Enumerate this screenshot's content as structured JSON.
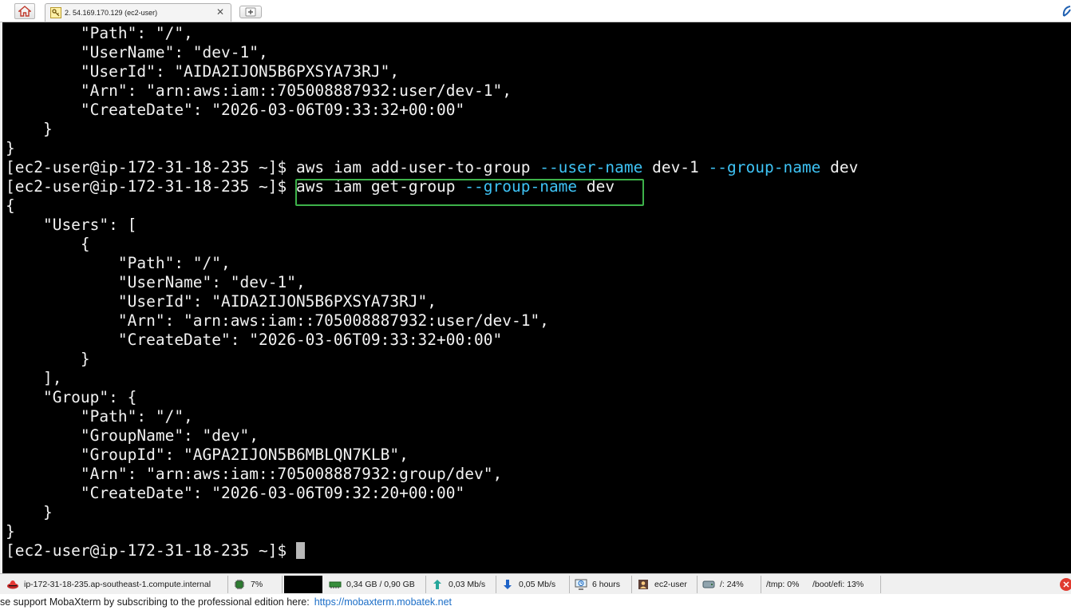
{
  "tab": {
    "title": "2. 54.169.170.129 (ec2-user)",
    "close_glyph": "✕"
  },
  "terminal": {
    "prompt": "[ec2-user@ip-172-31-18-235 ~]$ ",
    "highlight_color": "#3db24a",
    "option_color": "#3ec3f5",
    "lines": [
      "        \"Path\": \"/\",",
      "        \"UserName\": \"dev-1\",",
      "        \"UserId\": \"AIDA2IJON5B6PXSYA73RJ\",",
      "        \"Arn\": \"arn:aws:iam::705008887932:user/dev-1\",",
      "        \"CreateDate\": \"2026-03-06T09:33:32+00:00\"",
      "    }",
      "}",
      "__CMD1__",
      "__CMD2__",
      "{",
      "    \"Users\": [",
      "        {",
      "            \"Path\": \"/\",",
      "            \"UserName\": \"dev-1\",",
      "            \"UserId\": \"AIDA2IJON5B6PXSYA73RJ\",",
      "            \"Arn\": \"arn:aws:iam::705008887932:user/dev-1\",",
      "            \"CreateDate\": \"2026-03-06T09:33:32+00:00\"",
      "        }",
      "    ],",
      "    \"Group\": {",
      "        \"Path\": \"/\",",
      "        \"GroupName\": \"dev\",",
      "        \"GroupId\": \"AGPA2IJON5B6MBLQN7KLB\",",
      "        \"Arn\": \"arn:aws:iam::705008887932:group/dev\",",
      "        \"CreateDate\": \"2026-03-06T09:32:20+00:00\"",
      "    }",
      "}"
    ],
    "cmd1": {
      "base": "aws iam add-user-to-group ",
      "opt1": "--user-name",
      "val1": " dev-1 ",
      "opt2": "--group-name",
      "val2": " dev"
    },
    "cmd2": {
      "base": "aws iam get-group ",
      "opt1": "--group-name",
      "val1": " dev"
    }
  },
  "statusbar": {
    "host": "ip-172-31-18-235.ap-southeast-1.compute.internal",
    "cpu": "7%",
    "memory": "0,34 GB / 0,90 GB",
    "upload": "0,03 Mb/s",
    "download": "0,05 Mb/s",
    "uptime": "6 hours",
    "user": "ec2-user",
    "disk_root": "/: 24%",
    "disk_tmp": "/tmp: 0%",
    "disk_boot": "/boot/efi: 13%"
  },
  "banner": {
    "text": "se support MobaXterm by subscribing to the professional edition here:",
    "link": "https://mobaxterm.mobatek.net"
  }
}
